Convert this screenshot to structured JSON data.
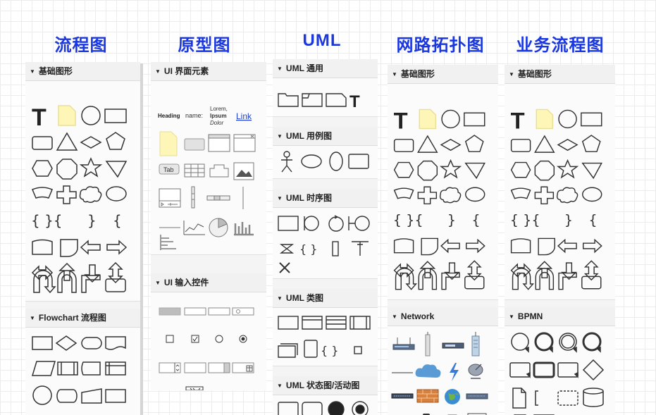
{
  "columns": [
    {
      "title": "流程图"
    },
    {
      "title": "原型图"
    },
    {
      "title": "UML"
    },
    {
      "title": "网路拓扑图"
    },
    {
      "title": "业务流程图"
    }
  ],
  "panel1": {
    "sections": [
      {
        "label": "基础图形"
      },
      {
        "label": "Flowchart 流程图"
      }
    ]
  },
  "panel2": {
    "sections": [
      {
        "label": "UI 界面元素"
      },
      {
        "label": "UI 输入控件"
      }
    ],
    "labels": {
      "heading": "Heading",
      "name": "name:",
      "lorem1": "Lorem,",
      "lorem2": "Ipsum",
      "lorem3": "Dolor",
      "link": "Link",
      "tab": "Tab"
    }
  },
  "panel3": {
    "sections": [
      {
        "label": "UML 通用"
      },
      {
        "label": "UML 用例图"
      },
      {
        "label": "UML 时序图"
      },
      {
        "label": "UML 类图"
      },
      {
        "label": "UML 状态图/活动图"
      }
    ],
    "braces": "{ }"
  },
  "panel4": {
    "sections": [
      {
        "label": "基础图形"
      },
      {
        "label": "Network"
      }
    ]
  },
  "panel5": {
    "sections": [
      {
        "label": "基础图形"
      },
      {
        "label": "BPMN"
      }
    ]
  },
  "glyphs": {
    "text_tool": "T",
    "brace_pair": "{ }{",
    "bracket": "}",
    "brace_left": "{",
    "brace_pair_uml": "{ }"
  },
  "colors": {
    "title": "#1a37e0",
    "note": "#fdf6b7",
    "stroke": "#333333"
  }
}
